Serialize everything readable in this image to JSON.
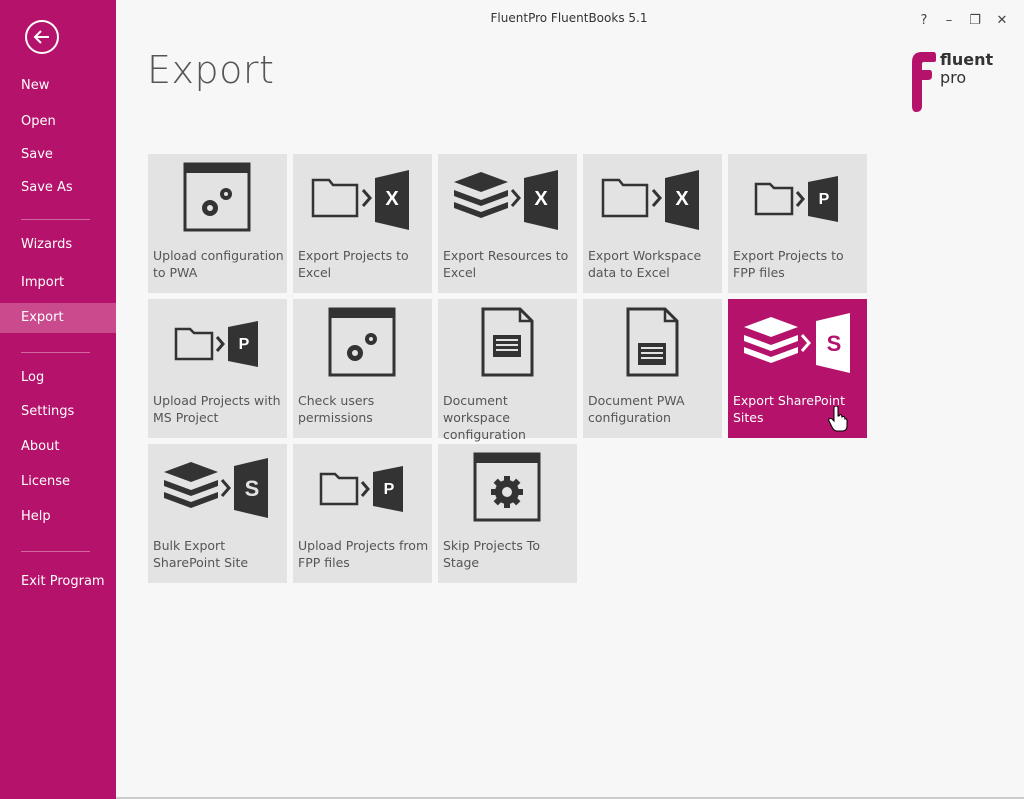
{
  "window": {
    "title": "FluentPro FluentBooks 5.1",
    "help_label": "?",
    "minimize_label": "–",
    "restore_label": "❐",
    "close_label": "✕"
  },
  "sidebar": {
    "items": [
      {
        "label": "New"
      },
      {
        "label": "Open"
      },
      {
        "label": "Save"
      },
      {
        "label": "Save As"
      },
      {
        "label": "Wizards"
      },
      {
        "label": "Import"
      },
      {
        "label": "Export",
        "active": true
      },
      {
        "label": "Log"
      },
      {
        "label": "Settings"
      },
      {
        "label": "About"
      },
      {
        "label": "License"
      },
      {
        "label": "Help"
      },
      {
        "label": "Exit Program"
      }
    ]
  },
  "page": {
    "title": "Export"
  },
  "logo": {
    "line1": "fluent",
    "line2": "pro"
  },
  "tiles": [
    {
      "label": "Upload configuration to PWA",
      "icon": "window-gears-icon"
    },
    {
      "label": "Export Projects to Excel",
      "icon": "folder-to-excel-icon"
    },
    {
      "label": "Export Resources to Excel",
      "icon": "layers-to-excel-icon"
    },
    {
      "label": "Export Workspace data to Excel",
      "icon": "folder-to-excel-icon"
    },
    {
      "label": "Export Projects to FPP files",
      "icon": "folder-to-project-icon"
    },
    {
      "label": "Upload Projects with MS Project",
      "icon": "folder-to-project-icon"
    },
    {
      "label": "Check users permissions",
      "icon": "window-gears-icon"
    },
    {
      "label": "Document workspace configuration",
      "icon": "document-icon"
    },
    {
      "label": "Document PWA configuration",
      "icon": "document-icon"
    },
    {
      "label": "Export SharePoint Sites",
      "icon": "layers-to-sharepoint-icon",
      "highlighted": true
    },
    {
      "label": "Bulk Export SharePoint Site",
      "icon": "layers-to-sharepoint-icon"
    },
    {
      "label": "Upload Projects from FPP files",
      "icon": "folder-to-project-icon"
    },
    {
      "label": "Skip Projects To Stage",
      "icon": "window-gear-icon"
    }
  ],
  "colors": {
    "brand": "#b5126b",
    "active_nav": "#c94b8e",
    "tile_bg": "#e3e3e3"
  }
}
